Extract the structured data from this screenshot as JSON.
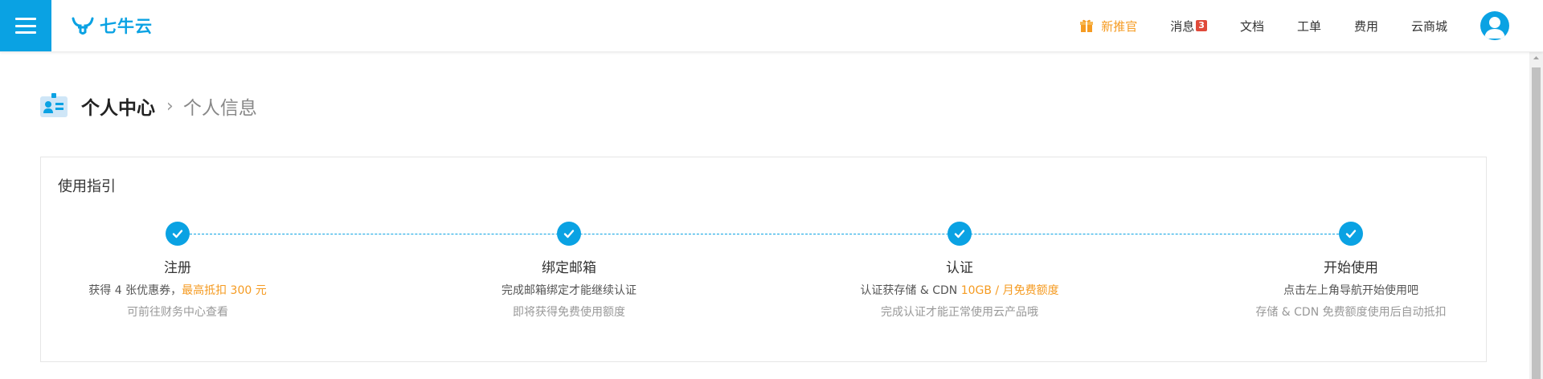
{
  "header": {
    "logo_text": "七牛云",
    "nav": {
      "new_promo": "新推官",
      "messages": "消息",
      "messages_count": "3",
      "docs": "文档",
      "tickets": "工单",
      "billing": "费用",
      "market": "云商城"
    }
  },
  "breadcrumb": {
    "current": "个人中心",
    "separator": "›",
    "page": "个人信息"
  },
  "guide": {
    "title": "使用指引",
    "steps": [
      {
        "title": "注册",
        "desc": "获得 4 张优惠券，",
        "desc_highlight": "最高抵扣 300 元",
        "sub": "可前往财务中心查看"
      },
      {
        "title": "绑定邮箱",
        "desc": "完成邮箱绑定才能继续认证",
        "desc_highlight": "",
        "sub": "即将获得免费使用额度"
      },
      {
        "title": "认证",
        "desc": "认证获存储 & CDN ",
        "desc_highlight": "10GB / 月免费额度",
        "sub": "完成认证才能正常使用云产品哦"
      },
      {
        "title": "开始使用",
        "desc": "点击左上角导航开始使用吧",
        "desc_highlight": "",
        "sub": "存储 & CDN 免费额度使用后自动抵扣"
      }
    ]
  },
  "icons": {
    "menu": "hamburger-icon",
    "logo": "qiniu-logo-icon",
    "gift": "gift-icon",
    "avatar": "user-avatar-icon",
    "breadcrumb": "id-card-icon",
    "step_done": "check-icon"
  },
  "colors": {
    "brand": "#0aa2e3",
    "highlight": "#f59b22",
    "badge": "#e04a3a"
  }
}
